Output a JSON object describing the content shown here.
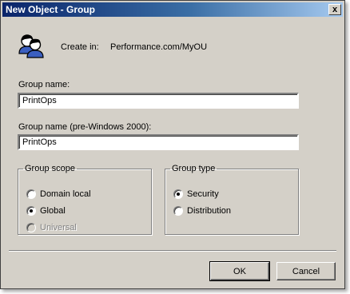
{
  "dialog": {
    "title": "New Object - Group",
    "close_glyph": "x",
    "icon": "group-users-icon"
  },
  "create_in": {
    "label": "Create in:",
    "value": "Performance.com/MyOU"
  },
  "group_name": {
    "label": "Group name:",
    "value": "PrintOps"
  },
  "group_name_pre2000": {
    "label": "Group name (pre-Windows 2000):",
    "value": "PrintOps"
  },
  "group_scope": {
    "legend": "Group scope",
    "options": [
      {
        "label": "Domain local",
        "checked": false,
        "enabled": true
      },
      {
        "label": "Global",
        "checked": true,
        "enabled": true
      },
      {
        "label": "Universal",
        "checked": false,
        "enabled": false
      }
    ]
  },
  "group_type": {
    "legend": "Group type",
    "options": [
      {
        "label": "Security",
        "checked": true,
        "enabled": true
      },
      {
        "label": "Distribution",
        "checked": false,
        "enabled": true
      }
    ]
  },
  "buttons": {
    "ok": "OK",
    "cancel": "Cancel"
  }
}
